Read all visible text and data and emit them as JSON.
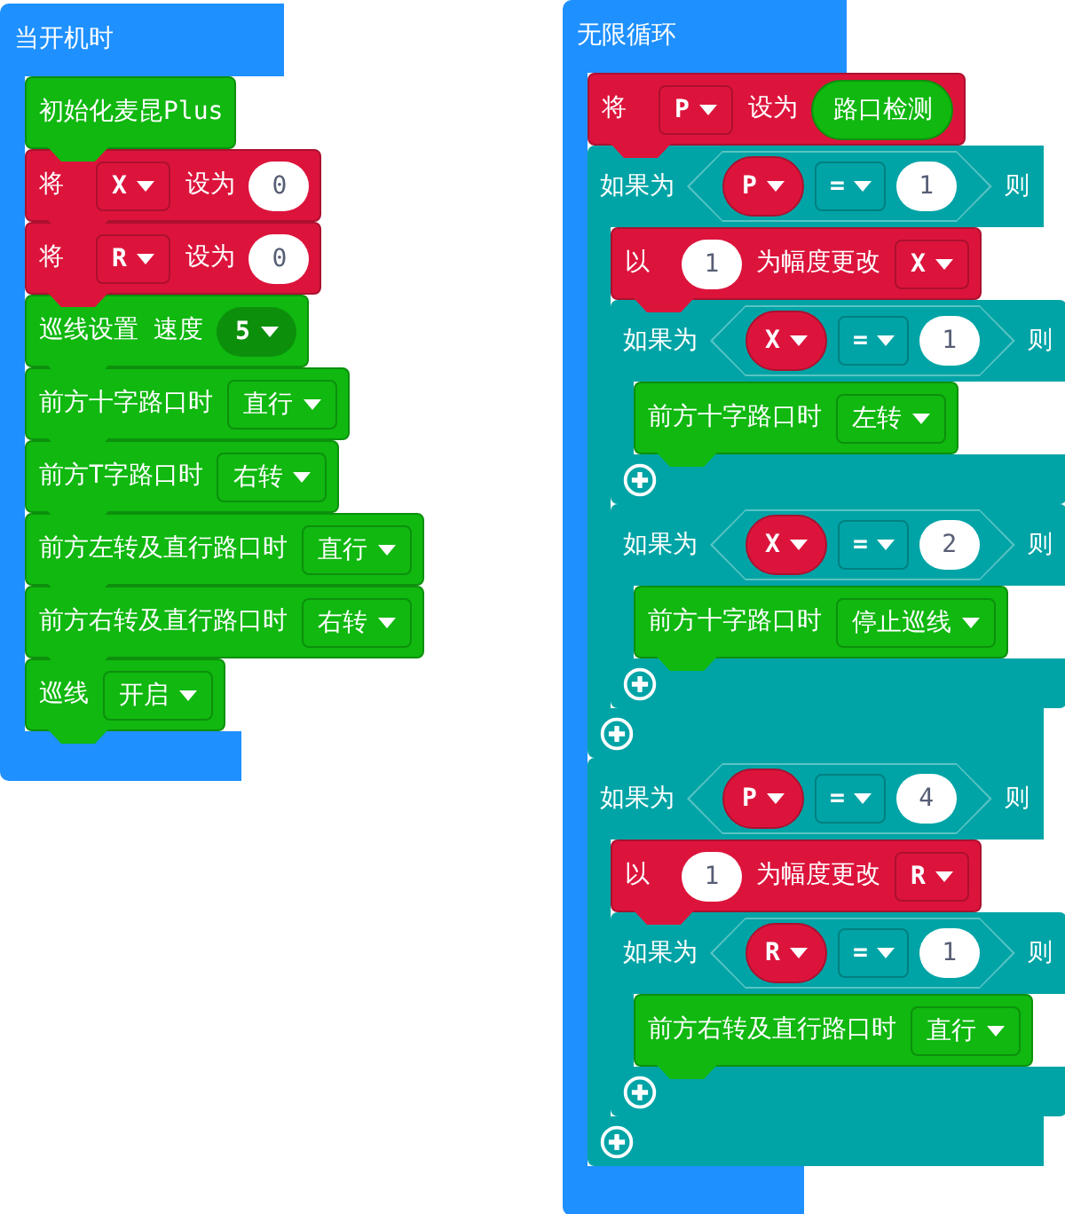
{
  "stacks": [
    {
      "kind": "event",
      "label": "当开机时",
      "body": [
        {
          "kind": "statement",
          "color": "#10b810",
          "parts": [
            {
              "kind": "text",
              "text": "初始化麦昆Plus"
            }
          ]
        },
        {
          "kind": "statement",
          "color": "#dc143c",
          "parts": [
            {
              "kind": "text",
              "text": "将"
            },
            {
              "kind": "variable_field",
              "text": "X"
            },
            {
              "kind": "text",
              "text": "设为"
            },
            {
              "kind": "number",
              "text": "0"
            }
          ]
        },
        {
          "kind": "statement",
          "color": "#dc143c",
          "parts": [
            {
              "kind": "text",
              "text": "将"
            },
            {
              "kind": "variable_field",
              "text": "R"
            },
            {
              "kind": "text",
              "text": "设为"
            },
            {
              "kind": "number",
              "text": "0"
            }
          ]
        },
        {
          "kind": "statement",
          "color": "#10b810",
          "parts": [
            {
              "kind": "text",
              "text": "巡线设置 速度"
            },
            {
              "kind": "round_dropdown",
              "text": "5"
            }
          ]
        },
        {
          "kind": "statement",
          "color": "#10b810",
          "parts": [
            {
              "kind": "text",
              "text": "前方十字路口时"
            },
            {
              "kind": "dropdown",
              "text": "直行"
            }
          ]
        },
        {
          "kind": "statement",
          "color": "#10b810",
          "parts": [
            {
              "kind": "text",
              "text": "前方T字路口时"
            },
            {
              "kind": "dropdown",
              "text": "右转"
            }
          ]
        },
        {
          "kind": "statement",
          "color": "#10b810",
          "parts": [
            {
              "kind": "text",
              "text": "前方左转及直行路口时"
            },
            {
              "kind": "dropdown",
              "text": "直行"
            }
          ]
        },
        {
          "kind": "statement",
          "color": "#10b810",
          "parts": [
            {
              "kind": "text",
              "text": "前方右转及直行路口时"
            },
            {
              "kind": "dropdown",
              "text": "右转"
            }
          ]
        },
        {
          "kind": "statement",
          "color": "#10b810",
          "parts": [
            {
              "kind": "text",
              "text": "巡线"
            },
            {
              "kind": "dropdown",
              "text": "开启"
            }
          ]
        }
      ]
    },
    {
      "kind": "event",
      "label": "无限循环",
      "body": [
        {
          "kind": "statement",
          "color": "#dc143c",
          "parts": [
            {
              "kind": "text",
              "text": "将"
            },
            {
              "kind": "variable_field",
              "text": "P"
            },
            {
              "kind": "text",
              "text": "设为"
            },
            {
              "kind": "reporter",
              "text": "路口检测",
              "color": "#10b810"
            }
          ]
        },
        {
          "kind": "if",
          "color": "#00a4a6",
          "label": "如果为",
          "condition": [
            {
              "kind": "variable",
              "text": "P",
              "color": "#dc143c"
            },
            {
              "kind": "operator",
              "text": "="
            },
            {
              "kind": "number",
              "text": "1"
            }
          ],
          "then": "则",
          "body": [
            {
              "kind": "statement",
              "color": "#dc143c",
              "parts": [
                {
                  "kind": "text",
                  "text": "以"
                },
                {
                  "kind": "number",
                  "text": "1"
                },
                {
                  "kind": "text",
                  "text": "为幅度更改"
                },
                {
                  "kind": "variable_field",
                  "text": "X"
                }
              ]
            },
            {
              "kind": "if",
              "color": "#00a4a6",
              "label": "如果为",
              "condition": [
                {
                  "kind": "variable",
                  "text": "X",
                  "color": "#dc143c"
                },
                {
                  "kind": "operator",
                  "text": "="
                },
                {
                  "kind": "number",
                  "text": "1"
                }
              ],
              "then": "则",
              "body": [
                {
                  "kind": "statement",
                  "color": "#10b810",
                  "parts": [
                    {
                      "kind": "text",
                      "text": "前方十字路口时"
                    },
                    {
                      "kind": "dropdown",
                      "text": "左转"
                    }
                  ]
                }
              ]
            },
            {
              "kind": "if",
              "color": "#00a4a6",
              "label": "如果为",
              "condition": [
                {
                  "kind": "variable",
                  "text": "X",
                  "color": "#dc143c"
                },
                {
                  "kind": "operator",
                  "text": "="
                },
                {
                  "kind": "number",
                  "text": "2"
                }
              ],
              "then": "则",
              "body": [
                {
                  "kind": "statement",
                  "color": "#10b810",
                  "parts": [
                    {
                      "kind": "text",
                      "text": "前方十字路口时"
                    },
                    {
                      "kind": "dropdown",
                      "text": "停止巡线"
                    }
                  ]
                }
              ]
            }
          ]
        },
        {
          "kind": "if",
          "color": "#00a4a6",
          "label": "如果为",
          "condition": [
            {
              "kind": "variable",
              "text": "P",
              "color": "#dc143c"
            },
            {
              "kind": "operator",
              "text": "="
            },
            {
              "kind": "number",
              "text": "4"
            }
          ],
          "then": "则",
          "body": [
            {
              "kind": "statement",
              "color": "#dc143c",
              "parts": [
                {
                  "kind": "text",
                  "text": "以"
                },
                {
                  "kind": "number",
                  "text": "1"
                },
                {
                  "kind": "text",
                  "text": "为幅度更改"
                },
                {
                  "kind": "variable_field",
                  "text": "R"
                }
              ]
            },
            {
              "kind": "if",
              "color": "#00a4a6",
              "label": "如果为",
              "condition": [
                {
                  "kind": "variable",
                  "text": "R",
                  "color": "#dc143c"
                },
                {
                  "kind": "operator",
                  "text": "="
                },
                {
                  "kind": "number",
                  "text": "1"
                }
              ],
              "then": "则",
              "body": [
                {
                  "kind": "statement",
                  "color": "#10b810",
                  "parts": [
                    {
                      "kind": "text",
                      "text": "前方右转及直行路口时"
                    },
                    {
                      "kind": "dropdown",
                      "text": "直行"
                    }
                  ]
                }
              ]
            }
          ]
        }
      ]
    }
  ]
}
